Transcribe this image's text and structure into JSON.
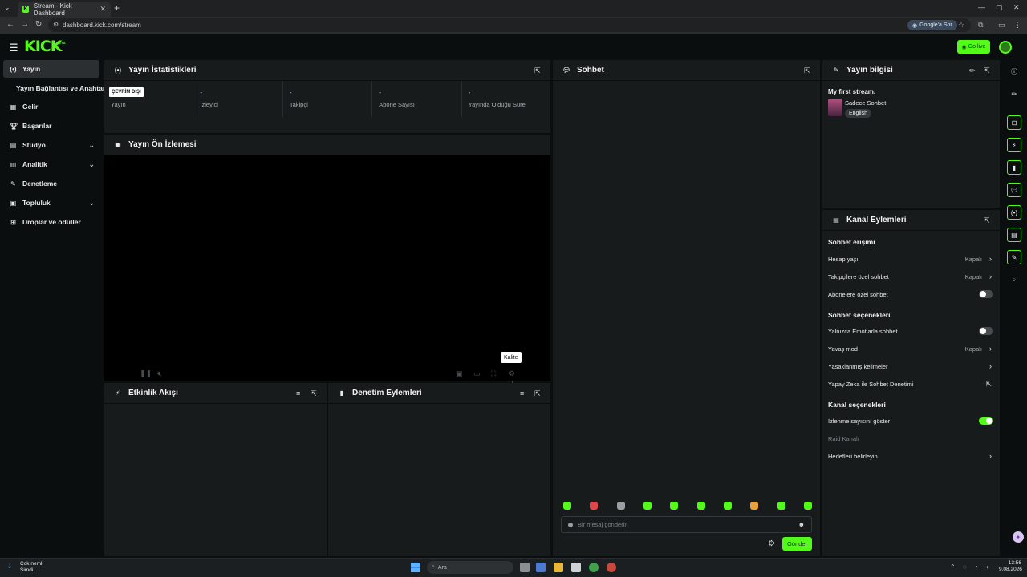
{
  "browser": {
    "tab_title": "Stream - Kick Dashboard",
    "url": "dashboard.kick.com/stream",
    "google_pill": "Google'a Sor"
  },
  "header": {
    "logo": "KICK",
    "beta": "BETA",
    "go_live": "Go live"
  },
  "sidebar": {
    "items": [
      {
        "label": "Yayın",
        "icon": "broadcast-icon"
      },
      {
        "label": "Yayın Bağlantısı ve Anahtarı"
      },
      {
        "label": "Gelir",
        "icon": "revenue-icon"
      },
      {
        "label": "Başarılar",
        "icon": "trophy-icon"
      },
      {
        "label": "Stüdyo",
        "icon": "studio-icon"
      },
      {
        "label": "Analitik",
        "icon": "analytics-icon"
      },
      {
        "label": "Denetleme",
        "icon": "wrench-icon"
      },
      {
        "label": "Topluluk",
        "icon": "community-icon"
      },
      {
        "label": "Droplar ve ödüller",
        "icon": "drops-icon"
      }
    ]
  },
  "stats_panel": {
    "title": "Yayın İstatistikleri",
    "offline_badge": "ÇEVRİM DIŞI",
    "stats": [
      {
        "value": "",
        "label": "Yayın"
      },
      {
        "value": "-",
        "label": "İzleyici"
      },
      {
        "value": "-",
        "label": "Takipçi"
      },
      {
        "value": "-",
        "label": "Abone Sayısı"
      },
      {
        "value": "-",
        "label": "Yayında Olduğu Süre"
      }
    ]
  },
  "preview_panel": {
    "title": "Yayın Ön İzlemesi",
    "tooltip": "Kalite"
  },
  "events_panel": {
    "title": "Etkinlik Akışı"
  },
  "moderation_panel": {
    "title": "Denetim Eylemleri"
  },
  "chat_panel": {
    "title": "Sohbet",
    "input_placeholder": "Bir mesaj gönderin",
    "send_label": "Gönder"
  },
  "stream_info": {
    "title": "Yayın bilgisi",
    "stream_title": "My first stream.",
    "category": "Sadece Sohbet",
    "language": "English"
  },
  "channel_actions": {
    "title": "Kanal Eylemleri",
    "chat_access": {
      "heading": "Sohbet erişimi",
      "account_age": {
        "label": "Hesap yaşı",
        "value": "Kapalı"
      },
      "followers_only": {
        "label": "Takipçilere özel sohbet",
        "value": "Kapalı"
      },
      "subscribers_only": {
        "label": "Abonelere özel sohbet",
        "enabled": false
      }
    },
    "chat_options": {
      "heading": "Sohbet seçenekleri",
      "emote_only": {
        "label": "Yalnızca Emotlarla sohbet",
        "enabled": false
      },
      "slow_mode": {
        "label": "Yavaş mod",
        "value": "Kapalı"
      },
      "banned_words": {
        "label": "Yasaklanmış kelimeler"
      },
      "ai_moderation": {
        "label": "Yapay Zeka ile Sohbet Denetimi"
      }
    },
    "channel_options": {
      "heading": "Kanal seçenekleri",
      "show_viewers": {
        "label": "İzlenme sayısını göster",
        "enabled": true
      },
      "raid": {
        "label": "Raid Kanalı"
      },
      "goals": {
        "label": "Hedefleri belirleyin"
      }
    }
  },
  "taskbar": {
    "weather_title": "Çok nemli",
    "weather_sub": "Şimdi",
    "search_label": "Ara",
    "time": "13:56",
    "date": "9.08.2026"
  },
  "colors": {
    "accent": "#53fc18",
    "panel": "#181b1c",
    "background": "#0b0e0f"
  }
}
